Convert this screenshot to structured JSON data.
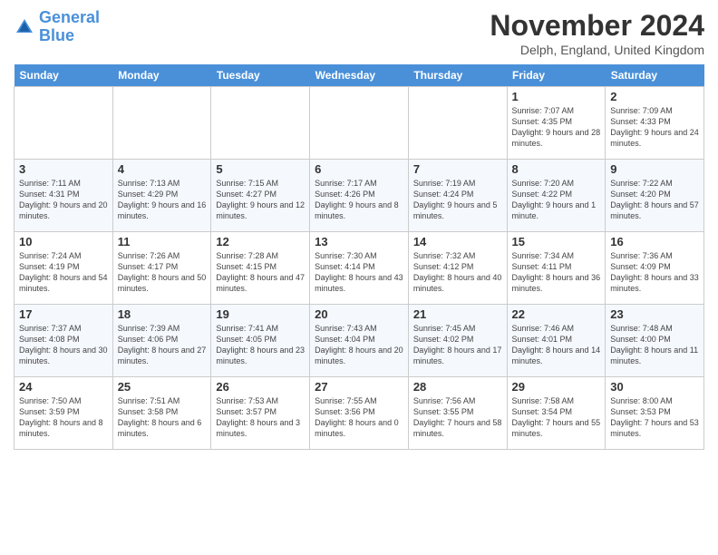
{
  "header": {
    "logo_line1": "General",
    "logo_line2": "Blue",
    "month": "November 2024",
    "location": "Delph, England, United Kingdom"
  },
  "weekdays": [
    "Sunday",
    "Monday",
    "Tuesday",
    "Wednesday",
    "Thursday",
    "Friday",
    "Saturday"
  ],
  "weeks": [
    [
      {
        "day": "",
        "info": ""
      },
      {
        "day": "",
        "info": ""
      },
      {
        "day": "",
        "info": ""
      },
      {
        "day": "",
        "info": ""
      },
      {
        "day": "",
        "info": ""
      },
      {
        "day": "1",
        "info": "Sunrise: 7:07 AM\nSunset: 4:35 PM\nDaylight: 9 hours and 28 minutes."
      },
      {
        "day": "2",
        "info": "Sunrise: 7:09 AM\nSunset: 4:33 PM\nDaylight: 9 hours and 24 minutes."
      }
    ],
    [
      {
        "day": "3",
        "info": "Sunrise: 7:11 AM\nSunset: 4:31 PM\nDaylight: 9 hours and 20 minutes."
      },
      {
        "day": "4",
        "info": "Sunrise: 7:13 AM\nSunset: 4:29 PM\nDaylight: 9 hours and 16 minutes."
      },
      {
        "day": "5",
        "info": "Sunrise: 7:15 AM\nSunset: 4:27 PM\nDaylight: 9 hours and 12 minutes."
      },
      {
        "day": "6",
        "info": "Sunrise: 7:17 AM\nSunset: 4:26 PM\nDaylight: 9 hours and 8 minutes."
      },
      {
        "day": "7",
        "info": "Sunrise: 7:19 AM\nSunset: 4:24 PM\nDaylight: 9 hours and 5 minutes."
      },
      {
        "day": "8",
        "info": "Sunrise: 7:20 AM\nSunset: 4:22 PM\nDaylight: 9 hours and 1 minute."
      },
      {
        "day": "9",
        "info": "Sunrise: 7:22 AM\nSunset: 4:20 PM\nDaylight: 8 hours and 57 minutes."
      }
    ],
    [
      {
        "day": "10",
        "info": "Sunrise: 7:24 AM\nSunset: 4:19 PM\nDaylight: 8 hours and 54 minutes."
      },
      {
        "day": "11",
        "info": "Sunrise: 7:26 AM\nSunset: 4:17 PM\nDaylight: 8 hours and 50 minutes."
      },
      {
        "day": "12",
        "info": "Sunrise: 7:28 AM\nSunset: 4:15 PM\nDaylight: 8 hours and 47 minutes."
      },
      {
        "day": "13",
        "info": "Sunrise: 7:30 AM\nSunset: 4:14 PM\nDaylight: 8 hours and 43 minutes."
      },
      {
        "day": "14",
        "info": "Sunrise: 7:32 AM\nSunset: 4:12 PM\nDaylight: 8 hours and 40 minutes."
      },
      {
        "day": "15",
        "info": "Sunrise: 7:34 AM\nSunset: 4:11 PM\nDaylight: 8 hours and 36 minutes."
      },
      {
        "day": "16",
        "info": "Sunrise: 7:36 AM\nSunset: 4:09 PM\nDaylight: 8 hours and 33 minutes."
      }
    ],
    [
      {
        "day": "17",
        "info": "Sunrise: 7:37 AM\nSunset: 4:08 PM\nDaylight: 8 hours and 30 minutes."
      },
      {
        "day": "18",
        "info": "Sunrise: 7:39 AM\nSunset: 4:06 PM\nDaylight: 8 hours and 27 minutes."
      },
      {
        "day": "19",
        "info": "Sunrise: 7:41 AM\nSunset: 4:05 PM\nDaylight: 8 hours and 23 minutes."
      },
      {
        "day": "20",
        "info": "Sunrise: 7:43 AM\nSunset: 4:04 PM\nDaylight: 8 hours and 20 minutes."
      },
      {
        "day": "21",
        "info": "Sunrise: 7:45 AM\nSunset: 4:02 PM\nDaylight: 8 hours and 17 minutes."
      },
      {
        "day": "22",
        "info": "Sunrise: 7:46 AM\nSunset: 4:01 PM\nDaylight: 8 hours and 14 minutes."
      },
      {
        "day": "23",
        "info": "Sunrise: 7:48 AM\nSunset: 4:00 PM\nDaylight: 8 hours and 11 minutes."
      }
    ],
    [
      {
        "day": "24",
        "info": "Sunrise: 7:50 AM\nSunset: 3:59 PM\nDaylight: 8 hours and 8 minutes."
      },
      {
        "day": "25",
        "info": "Sunrise: 7:51 AM\nSunset: 3:58 PM\nDaylight: 8 hours and 6 minutes."
      },
      {
        "day": "26",
        "info": "Sunrise: 7:53 AM\nSunset: 3:57 PM\nDaylight: 8 hours and 3 minutes."
      },
      {
        "day": "27",
        "info": "Sunrise: 7:55 AM\nSunset: 3:56 PM\nDaylight: 8 hours and 0 minutes."
      },
      {
        "day": "28",
        "info": "Sunrise: 7:56 AM\nSunset: 3:55 PM\nDaylight: 7 hours and 58 minutes."
      },
      {
        "day": "29",
        "info": "Sunrise: 7:58 AM\nSunset: 3:54 PM\nDaylight: 7 hours and 55 minutes."
      },
      {
        "day": "30",
        "info": "Sunrise: 8:00 AM\nSunset: 3:53 PM\nDaylight: 7 hours and 53 minutes."
      }
    ]
  ]
}
